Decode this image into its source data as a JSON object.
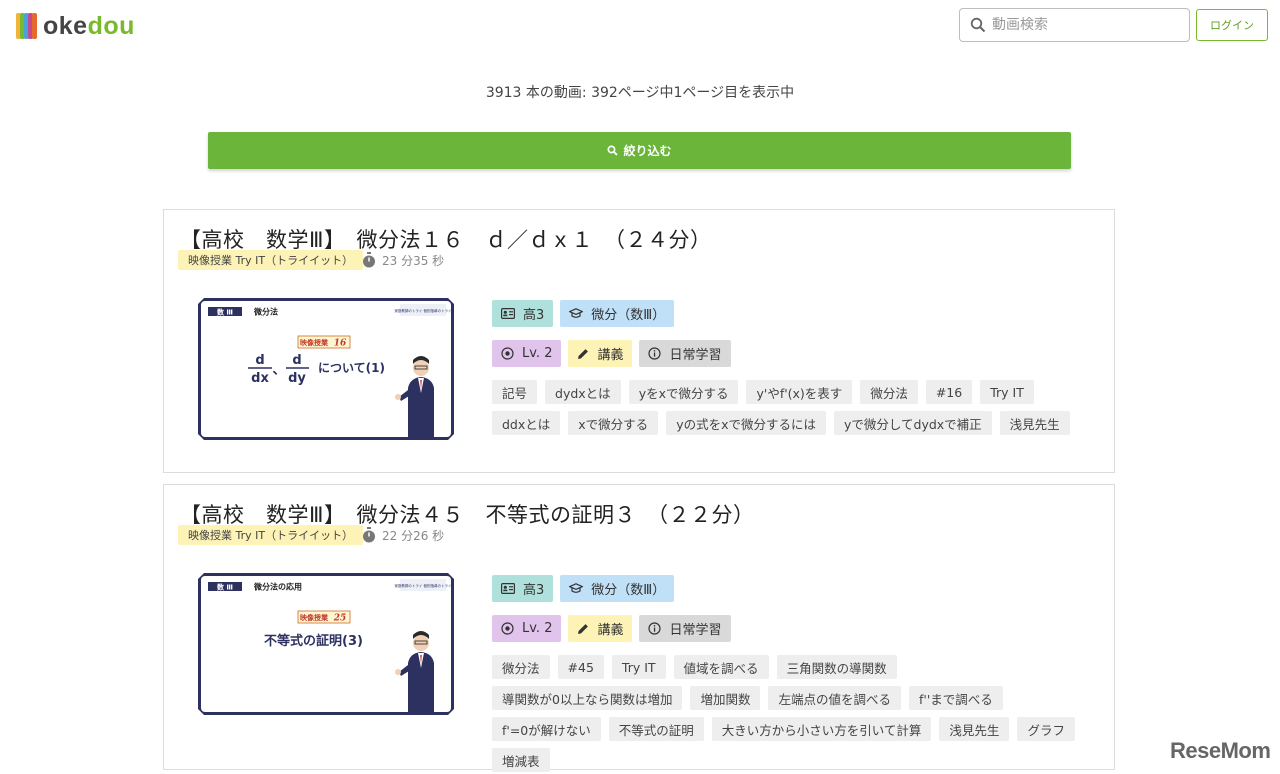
{
  "header": {
    "logo": {
      "part1": "oke",
      "part2": "dou"
    },
    "search": {
      "placeholder": "動画検索"
    },
    "login_label": "ログイン"
  },
  "result_count": "3913 本の動画: 392ページ中1ページ目を表示中",
  "filter_label": "絞り込む",
  "colors": {
    "accent": "#6ab53a",
    "grade": "#b0e0dc",
    "subject": "#bfe0f7",
    "level": "#e1c4ec",
    "type": "#fdf3b6",
    "purpose": "#d9d9d9"
  },
  "videos": [
    {
      "title": "【高校　数学Ⅲ】　微分法１６　ｄ／ｄｘ１　（２４分）",
      "source": "映像授業 Try IT（トライイット）",
      "duration": "23 分35 秒",
      "thumbnail": {
        "subject": "数 Ⅲ",
        "unit": "微分法",
        "lesson_label": "映像授業",
        "lesson_no": "16",
        "brand": "家庭教師のトライ 個別指導のトライ",
        "caption": "について(1)"
      },
      "grade": "高3",
      "subject": "微分（数Ⅲ）",
      "level": "Lv. 2",
      "type": "講義",
      "purpose": "日常学習",
      "tags": [
        "記号",
        "dydxとは",
        "yをxで微分する",
        "y'やf'(x)を表す",
        "微分法",
        "#16",
        "Try IT",
        "ddxとは",
        "xで微分する",
        "yの式をxで微分するには",
        "yで微分してdydxで補正",
        "浅見先生"
      ]
    },
    {
      "title": "【高校　数学Ⅲ】　微分法４５　不等式の証明３　（２２分）",
      "source": "映像授業 Try IT（トライイット）",
      "duration": "22 分26 秒",
      "thumbnail": {
        "subject": "数 Ⅲ",
        "unit": "微分法の応用",
        "lesson_label": "映像授業",
        "lesson_no": "25",
        "brand": "家庭教師のトライ 個別指導のトライ",
        "caption": "不等式の証明(3)"
      },
      "grade": "高3",
      "subject": "微分（数Ⅲ）",
      "level": "Lv. 2",
      "type": "講義",
      "purpose": "日常学習",
      "tags": [
        "微分法",
        "#45",
        "Try IT",
        "値域を調べる",
        "三角関数の導関数",
        "導関数が0以上なら関数は増加",
        "増加関数",
        "左端点の値を調べる",
        "f''まで調べる",
        "f'=0が解けない",
        "不等式の証明",
        "大きい方から小さい方を引いて計算",
        "浅見先生",
        "グラフ",
        "増減表"
      ]
    }
  ],
  "watermark": "ReseMom"
}
